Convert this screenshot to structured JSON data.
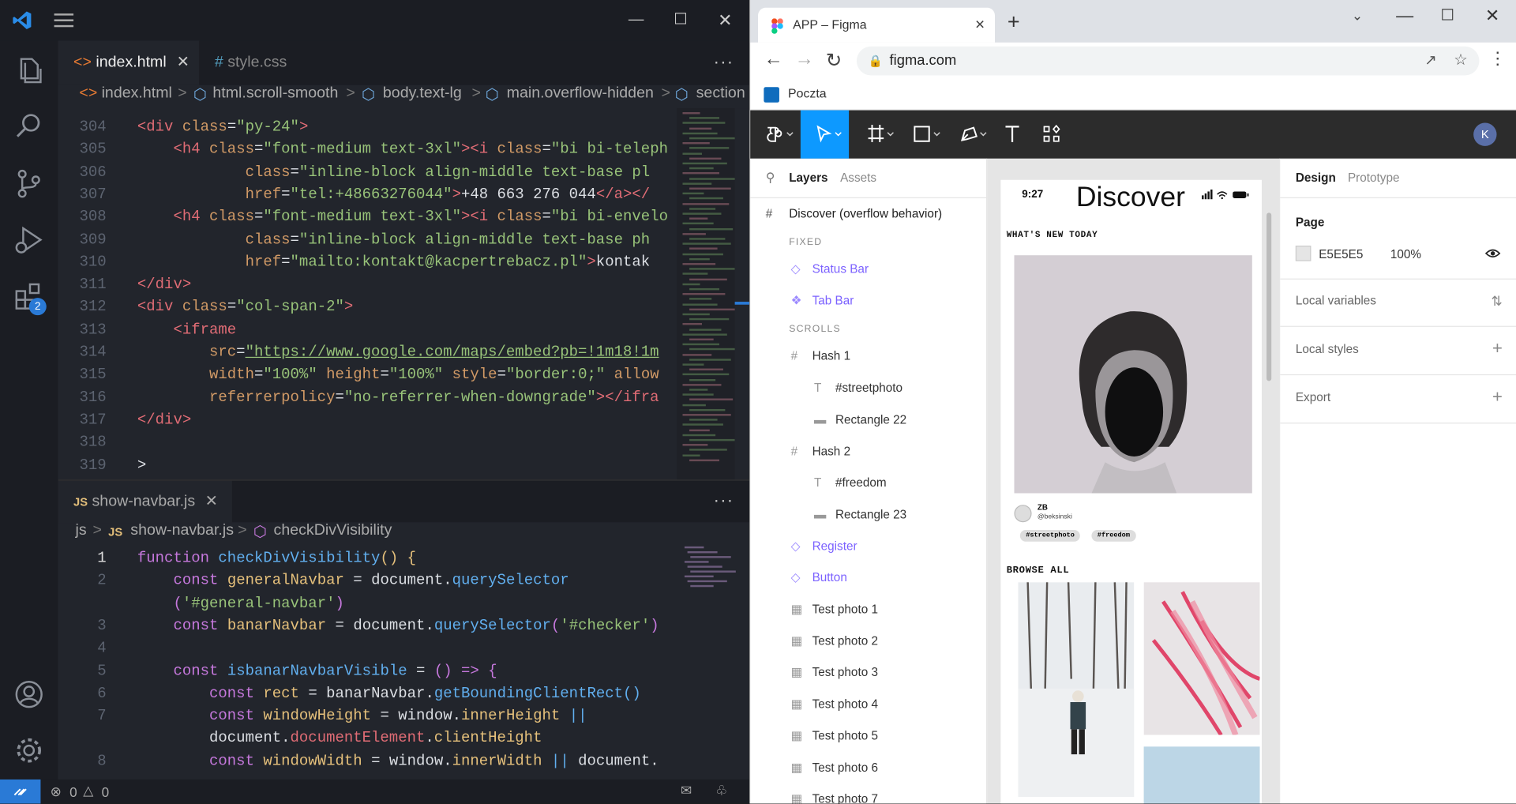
{
  "vscode": {
    "tabs": [
      {
        "label": "index.html",
        "icon": "html-icon",
        "active": true
      },
      {
        "label": "style.css",
        "icon": "css-icon",
        "active": false
      }
    ],
    "breadcrumb": [
      "index.html",
      "html.scroll-smooth",
      "body.text-lg",
      "main.overflow-hidden",
      "section"
    ],
    "activity_badge": "2",
    "editor1_lines": [
      {
        "n": "304",
        "html": "<span class=\"c-tag\">&lt;div</span> <span class=\"c-attr\">class</span><span class=\"c-plain\">=</span><span class=\"c-str\">\"py-24\"</span><span class=\"c-tag\">&gt;</span>"
      },
      {
        "n": "305",
        "html": "    <span class=\"c-tag\">&lt;h4</span> <span class=\"c-attr\">class</span><span class=\"c-plain\">=</span><span class=\"c-str\">\"font-medium text-3xl\"</span><span class=\"c-tag\">&gt;&lt;i</span> <span class=\"c-attr\">class</span><span class=\"c-plain\">=</span><span class=\"c-str\">\"bi bi-teleph</span>"
      },
      {
        "n": "306",
        "html": "            <span class=\"c-attr\">class</span><span class=\"c-plain\">=</span><span class=\"c-str\">\"inline-block align-middle text-base pl</span>"
      },
      {
        "n": "307",
        "html": "            <span class=\"c-attr\">href</span><span class=\"c-plain\">=</span><span class=\"c-str\">\"tel:+48663276044\"</span><span class=\"c-tag\">&gt;</span><span class=\"c-txt\">+48 663 276 044</span><span class=\"c-tag\">&lt;/a&gt;&lt;/</span>"
      },
      {
        "n": "308",
        "html": "    <span class=\"c-tag\">&lt;h4</span> <span class=\"c-attr\">class</span><span class=\"c-plain\">=</span><span class=\"c-str\">\"font-medium text-3xl\"</span><span class=\"c-tag\">&gt;&lt;i</span> <span class=\"c-attr\">class</span><span class=\"c-plain\">=</span><span class=\"c-str\">\"bi bi-envelo</span>"
      },
      {
        "n": "309",
        "html": "            <span class=\"c-attr\">class</span><span class=\"c-plain\">=</span><span class=\"c-str\">\"inline-block align-middle text-base ph</span>"
      },
      {
        "n": "310",
        "html": "            <span class=\"c-attr\">href</span><span class=\"c-plain\">=</span><span class=\"c-str\">\"mailto:kontakt@kacpertrebacz.pl\"</span><span class=\"c-tag\">&gt;</span><span class=\"c-txt\">kontak</span>"
      },
      {
        "n": "311",
        "html": "<span class=\"c-tag\">&lt;/div&gt;</span>"
      },
      {
        "n": "312",
        "html": "<span class=\"c-tag\">&lt;div</span> <span class=\"c-attr\">class</span><span class=\"c-plain\">=</span><span class=\"c-str\">\"col-span-2\"</span><span class=\"c-tag\">&gt;</span>"
      },
      {
        "n": "313",
        "html": "    <span class=\"c-tag\">&lt;iframe</span>"
      },
      {
        "n": "314",
        "html": "        <span class=\"c-attr\">src</span><span class=\"c-plain\">=</span><span class=\"c-str\" style=\"text-decoration:underline\">\"https://www.google.com/maps/embed?pb=!1m18!1m</span>"
      },
      {
        "n": "315",
        "html": "        <span class=\"c-attr\">width</span><span class=\"c-plain\">=</span><span class=\"c-str\">\"100%\"</span> <span class=\"c-attr\">height</span><span class=\"c-plain\">=</span><span class=\"c-str\">\"100%\"</span> <span class=\"c-attr\">style</span><span class=\"c-plain\">=</span><span class=\"c-str\">\"border:0;\"</span> <span class=\"c-attr\">allow</span>"
      },
      {
        "n": "316",
        "html": "        <span class=\"c-attr\">referrerpolicy</span><span class=\"c-plain\">=</span><span class=\"c-str\">\"no-referrer-when-downgrade\"</span><span class=\"c-tag\">&gt;&lt;/ifra</span>"
      },
      {
        "n": "317",
        "html": "<span class=\"c-tag\">&lt;/div&gt;</span>"
      },
      {
        "n": "318",
        "html": ""
      },
      {
        "n": "319",
        "html": "<span class=\"c-plain\">&gt;</span>"
      }
    ],
    "panel2": {
      "tab_label": "show-navbar.js",
      "breadcrumb": [
        "js",
        "show-navbar.js",
        "checkDivVisibility"
      ]
    },
    "editor2_lines": [
      {
        "n": "1",
        "cur": true,
        "html": "<span class=\"c-kw\">function</span> <span class=\"c-fn\">checkDivVisibility</span><span class=\"c-var\">()</span> <span class=\"c-var\">{</span>"
      },
      {
        "n": "2",
        "html": "    <span class=\"c-kw\">const</span> <span class=\"c-var\">generalNavbar</span> <span class=\"c-plain\">=</span> <span class=\"c-plain\">document.</span><span class=\"c-fn\">querySelector</span>"
      },
      {
        "n": "",
        "html": "    <span class=\"c-kw\">(</span><span class=\"c-str\">'#general-navbar'</span><span class=\"c-kw\">)</span>"
      },
      {
        "n": "3",
        "html": "    <span class=\"c-kw\">const</span> <span class=\"c-var\">banarNavbar</span> <span class=\"c-plain\">=</span> <span class=\"c-plain\">document.</span><span class=\"c-fn\">querySelector</span><span class=\"c-kw\">(</span><span class=\"c-str\">'#checker'</span><span class=\"c-kw\">)</span>"
      },
      {
        "n": "4",
        "html": ""
      },
      {
        "n": "5",
        "html": "    <span class=\"c-kw\">const</span> <span class=\"c-fn\">isbanarNavbarVisible</span> <span class=\"c-plain\">=</span> <span class=\"c-kw\">()</span> <span class=\"c-kw\">=&gt;</span> <span class=\"c-kw\">{</span>"
      },
      {
        "n": "6",
        "html": "        <span class=\"c-kw\">const</span> <span class=\"c-var\">rect</span> <span class=\"c-plain\">=</span> <span class=\"c-plain\">banarNavbar.</span><span class=\"c-fn\">getBoundingClientRect</span><span class=\"c-fn\">()</span>"
      },
      {
        "n": "7",
        "html": "        <span class=\"c-kw\">const</span> <span class=\"c-var\">windowHeight</span> <span class=\"c-plain\">=</span> <span class=\"c-plain\">window.</span><span class=\"c-var\">innerHeight</span> <span class=\"c-fn\">||</span>"
      },
      {
        "n": "",
        "html": "        <span class=\"c-plain\">document.</span><span class=\"c-prop\">documentElement</span><span class=\"c-plain\">.</span><span class=\"c-var\">clientHeight</span>"
      },
      {
        "n": "8",
        "html": "        <span class=\"c-kw\">const</span> <span class=\"c-var\">windowWidth</span> <span class=\"c-plain\">=</span> <span class=\"c-plain\">window.</span><span class=\"c-var\">innerWidth</span> <span class=\"c-fn\">||</span> <span class=\"c-plain\">document.</span>"
      }
    ],
    "status": {
      "errors": "0",
      "warnings": "0"
    }
  },
  "chrome": {
    "tab_title": "APP – Figma",
    "url": "figma.com",
    "bookmark": "Poczta"
  },
  "figma": {
    "left_tabs": [
      "Layers",
      "Assets"
    ],
    "page_frame": "Discover (overflow behavior)",
    "sections": {
      "fixed": "FIXED",
      "scrolls": "SCROLLS"
    },
    "layers": [
      {
        "label": "Status Bar",
        "icon": "component-icon",
        "purple": true,
        "indent": 1
      },
      {
        "label": "Tab Bar",
        "icon": "component-set-icon",
        "purple": true,
        "indent": 1
      },
      {
        "label": "Hash 1",
        "icon": "frame-icon",
        "purple": false,
        "indent": 1
      },
      {
        "label": "#streetphoto",
        "icon": "text-icon",
        "purple": false,
        "indent": 2
      },
      {
        "label": "Rectangle 22",
        "icon": "rectangle-icon",
        "purple": false,
        "indent": 2
      },
      {
        "label": "Hash 2",
        "icon": "frame-icon",
        "purple": false,
        "indent": 1
      },
      {
        "label": "#freedom",
        "icon": "text-icon",
        "purple": false,
        "indent": 2
      },
      {
        "label": "Rectangle 23",
        "icon": "rectangle-icon",
        "purple": false,
        "indent": 2
      },
      {
        "label": "Register",
        "icon": "component-icon",
        "purple": true,
        "indent": 1
      },
      {
        "label": "Button",
        "icon": "component-icon",
        "purple": true,
        "indent": 1
      },
      {
        "label": "Test photo 1",
        "icon": "image-icon",
        "purple": false,
        "indent": 1
      },
      {
        "label": "Test photo 2",
        "icon": "image-icon",
        "purple": false,
        "indent": 1
      },
      {
        "label": "Test photo 3",
        "icon": "image-icon",
        "purple": false,
        "indent": 1
      },
      {
        "label": "Test photo 4",
        "icon": "image-icon",
        "purple": false,
        "indent": 1
      },
      {
        "label": "Test photo 5",
        "icon": "image-icon",
        "purple": false,
        "indent": 1
      },
      {
        "label": "Test photo 6",
        "icon": "image-icon",
        "purple": false,
        "indent": 1
      },
      {
        "label": "Test photo 7",
        "icon": "image-icon",
        "purple": false,
        "indent": 1
      }
    ],
    "right_tabs": [
      "Design",
      "Prototype"
    ],
    "page_label": "Page",
    "page_color": "E5E5E5",
    "page_opacity": "100%",
    "page_swatch": "#E5E5E5",
    "right_rows": [
      "Local variables",
      "Local styles",
      "Export"
    ],
    "avatar_initial": "K",
    "phone": {
      "time": "9:27",
      "title": "Discover",
      "whats_new": "WHAT'S NEW TODAY",
      "author_name": "ZB",
      "author_handle": "@beksinski",
      "tags": [
        "#streetphoto",
        "#freedom"
      ],
      "browse_all": "BROWSE ALL"
    }
  }
}
